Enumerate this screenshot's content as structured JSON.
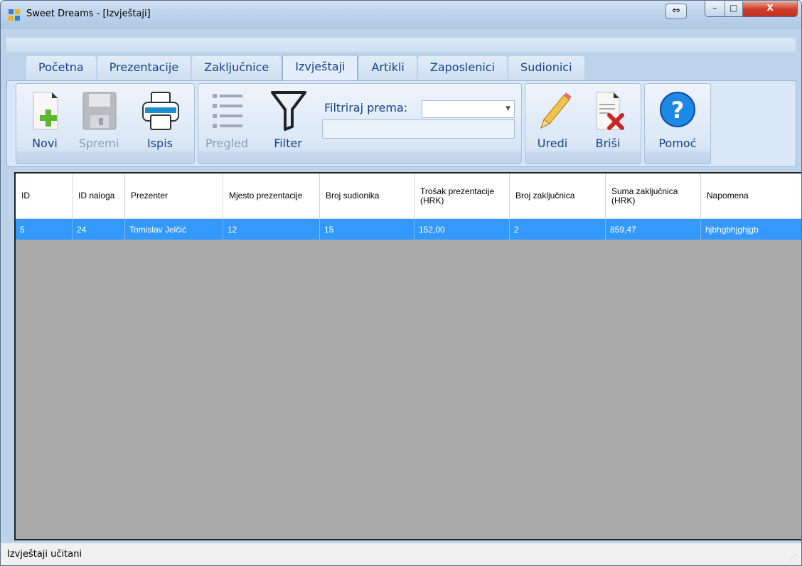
{
  "window": {
    "title": "Sweet Dreams - [Izvještaji]",
    "controls": {
      "restore_arrows": "⇔",
      "minimize": "–",
      "maximize": "□",
      "close": "X"
    }
  },
  "tabs": [
    {
      "label": "Početna",
      "active": false
    },
    {
      "label": "Prezentacije",
      "active": false
    },
    {
      "label": "Zaključnice",
      "active": false
    },
    {
      "label": "Izvještaji",
      "active": true
    },
    {
      "label": "Artikli",
      "active": false
    },
    {
      "label": "Zaposlenici",
      "active": false
    },
    {
      "label": "Sudionici",
      "active": false
    }
  ],
  "ribbon": {
    "new_label": "Novi",
    "save_label": "Spremi",
    "print_label": "Ispis",
    "preview_label": "Pregled",
    "filter_label": "Filter",
    "filter_by_label": "Filtriraj prema:",
    "filter_combo_value": "",
    "filter_text_value": "",
    "edit_label": "Uredi",
    "delete_label": "Briši",
    "help_label": "Pomoć"
  },
  "grid": {
    "columns": [
      "ID",
      "ID naloga",
      "Prezenter",
      "Mjesto prezentacije",
      "Broj sudionika",
      "Trošak prezentacije (HRK)",
      "Broj zaključnica",
      "Suma zaključnica (HRK)",
      "Napomena"
    ],
    "rows": [
      [
        "5",
        "24",
        "Tomislav Jelčić",
        "12",
        "15",
        "152,00",
        "2",
        "859,47",
        "hjbhgbhjghjgb"
      ]
    ],
    "selected_row": 0,
    "colors": {
      "selection": "#3399ff",
      "empty_area": "#ababab"
    }
  },
  "status": {
    "text": "Izvještaji učitani"
  },
  "colors": {
    "ribbon_text": "#15428b",
    "title_bar": "#b9d1ea"
  }
}
